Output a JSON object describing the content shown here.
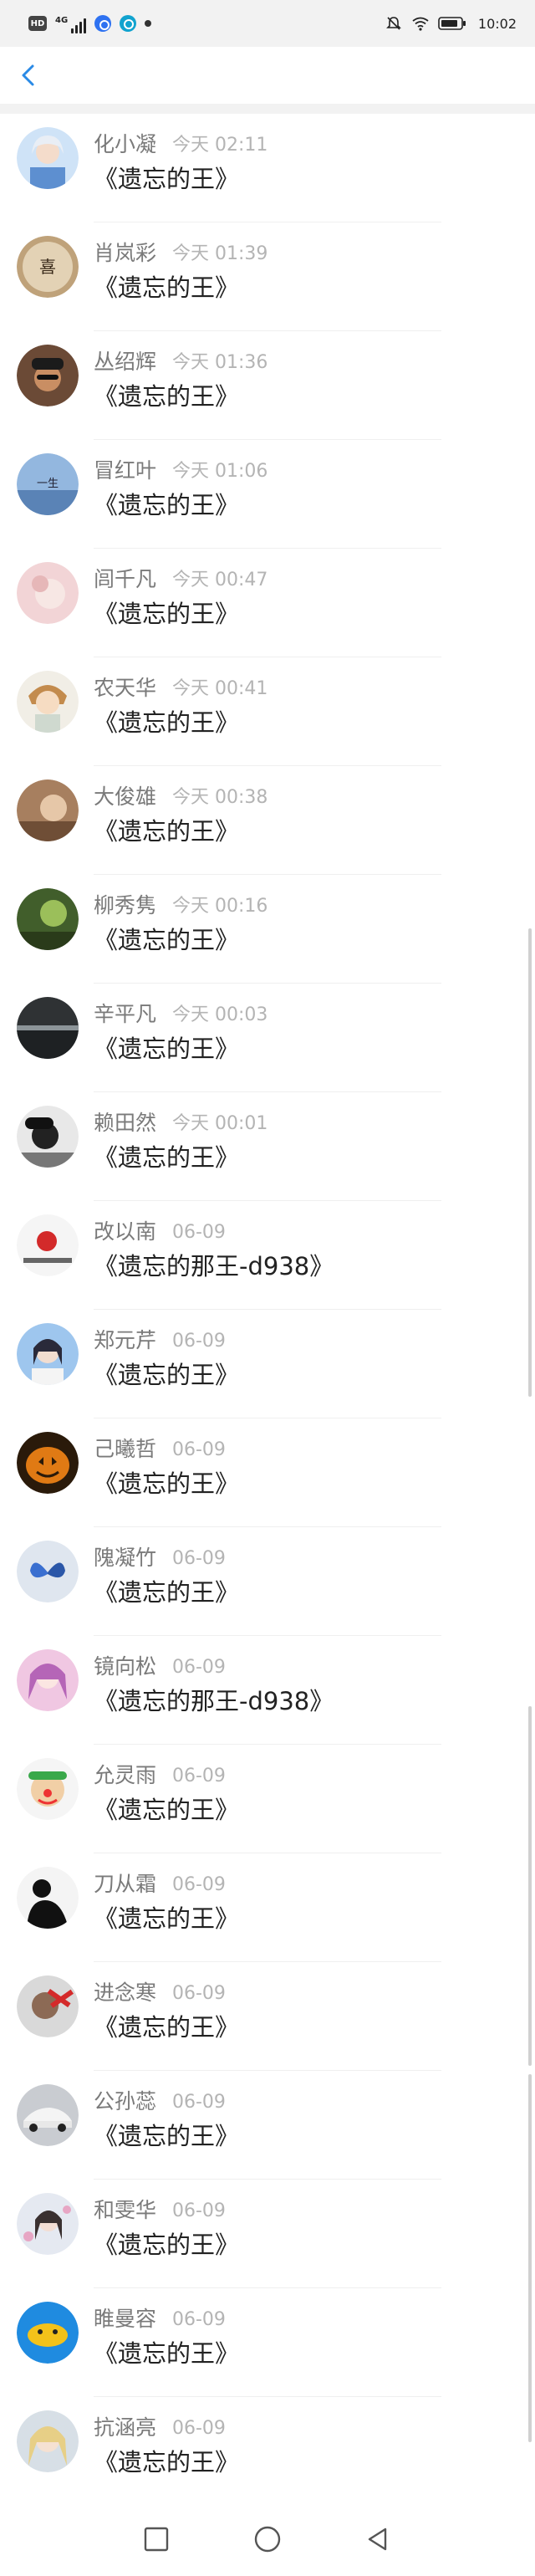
{
  "status_bar": {
    "hd_label": "HD",
    "network_label": "4G",
    "time": "10:02",
    "icons": [
      "hd-icon",
      "signal-icon",
      "app-icon",
      "app-icon",
      "notification-dot-icon",
      "mute-icon",
      "wifi-icon",
      "battery-icon"
    ]
  },
  "header": {
    "back_icon": "chevron-left-icon",
    "accent_color": "#2a8ae6"
  },
  "list": {
    "items": [
      {
        "name": "化小凝",
        "time": "今天 02:11",
        "message": "《遗忘的王》",
        "avatar_style": "anime-girl-light"
      },
      {
        "name": "肖岚彩",
        "time": "今天 01:39",
        "message": "《遗忘的王》",
        "avatar_style": "calligraphy"
      },
      {
        "name": "丛绍辉",
        "time": "今天 01:36",
        "message": "《遗忘的王》",
        "avatar_style": "dark-hat-man"
      },
      {
        "name": "冒红叶",
        "time": "今天 01:06",
        "message": "《遗忘的王》",
        "avatar_style": "sky-text"
      },
      {
        "name": "闾千凡",
        "time": "今天 00:47",
        "message": "《遗忘的王》",
        "avatar_style": "pink-blur"
      },
      {
        "name": "农天华",
        "time": "今天 00:41",
        "message": "《遗忘的王》",
        "avatar_style": "cartoon-kid"
      },
      {
        "name": "大俊雄",
        "time": "今天 00:38",
        "message": "《遗忘的王》",
        "avatar_style": "brown-photo"
      },
      {
        "name": "柳秀隽",
        "time": "今天 00:16",
        "message": "《遗忘的王》",
        "avatar_style": "green-nature"
      },
      {
        "name": "辛平凡",
        "time": "今天 00:03",
        "message": "《遗忘的王》",
        "avatar_style": "dark-sea"
      },
      {
        "name": "赖田然",
        "time": "今天 00:01",
        "message": "《遗忘的王》",
        "avatar_style": "bw-portrait"
      },
      {
        "name": "改以南",
        "time": "06-09",
        "message": "《遗忘的那王-d938》",
        "avatar_style": "red-white"
      },
      {
        "name": "郑元芹",
        "time": "06-09",
        "message": "《遗忘的王》",
        "avatar_style": "blue-girl"
      },
      {
        "name": "己曦哲",
        "time": "06-09",
        "message": "《遗忘的王》",
        "avatar_style": "pumpkin"
      },
      {
        "name": "隗凝竹",
        "time": "06-09",
        "message": "《遗忘的王》",
        "avatar_style": "butterfly"
      },
      {
        "name": "镜向松",
        "time": "06-09",
        "message": "《遗忘的那王-d938》",
        "avatar_style": "pink-anime"
      },
      {
        "name": "允灵雨",
        "time": "06-09",
        "message": "《遗忘的王》",
        "avatar_style": "clown"
      },
      {
        "name": "刀从霜",
        "time": "06-09",
        "message": "《遗忘的王》",
        "avatar_style": "silhouette"
      },
      {
        "name": "进念寒",
        "time": "06-09",
        "message": "《遗忘的王》",
        "avatar_style": "red-x-man"
      },
      {
        "name": "公孙蕊",
        "time": "06-09",
        "message": "《遗忘的王》",
        "avatar_style": "car"
      },
      {
        "name": "和雯华",
        "time": "06-09",
        "message": "《遗忘的王》",
        "avatar_style": "girl-flowers"
      },
      {
        "name": "睢曼容",
        "time": "06-09",
        "message": "《遗忘的王》",
        "avatar_style": "cartoon-blue-yellow"
      },
      {
        "name": "抗涵亮",
        "time": "06-09",
        "message": "《遗忘的王》",
        "avatar_style": "blonde-anime"
      }
    ]
  },
  "nav_bar": {
    "icons": [
      "recent-apps-icon",
      "home-icon",
      "back-icon"
    ]
  }
}
